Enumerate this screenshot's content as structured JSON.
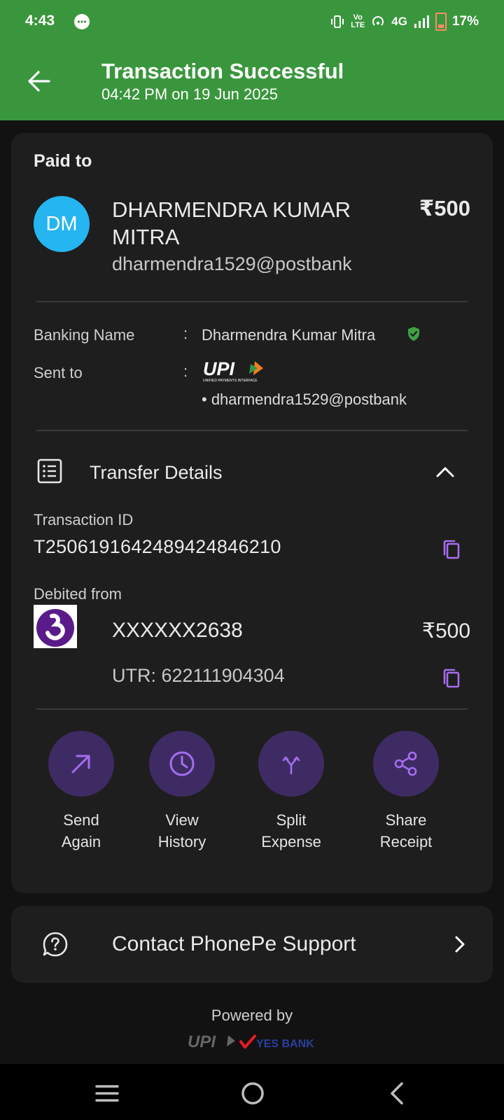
{
  "status_bar": {
    "time": "4:43",
    "network": "4G",
    "volte": "Vo LTE",
    "battery": "17%"
  },
  "header": {
    "title": "Transaction Successful",
    "subtitle": "04:42 PM on 19 Jun 2025",
    "bg_color": "#3a963d"
  },
  "payee": {
    "section_label": "Paid to",
    "initials": "DM",
    "name": "DHARMENDRA KUMAR MITRA",
    "amount": "₹500",
    "upi_id": "dharmendra1529@postbank",
    "avatar_color": "#25b5f1"
  },
  "details": {
    "banking_name_label": "Banking Name",
    "banking_name": "Dharmendra Kumar Mitra",
    "sent_to_label": "Sent to",
    "sent_to_upi": "• dharmendra1529@postbank",
    "colon": ":",
    "upi_logo_text": "UPI",
    "upi_logo_sub": "UNIFIED PAYMENTS INTERFACE"
  },
  "transfer": {
    "section_label": "Transfer Details",
    "txn_id_label": "Transaction ID",
    "txn_id": "T2506191642489424846210",
    "debited_label": "Debited from",
    "account": "XXXXXX2638",
    "amount": "₹500",
    "utr": "UTR: 622111904304"
  },
  "actions": [
    {
      "line1": "Send",
      "line2": "Again",
      "icon": "arrow-up-right-icon"
    },
    {
      "line1": "View",
      "line2": "History",
      "icon": "clock-icon"
    },
    {
      "line1": "Split",
      "line2": "Expense",
      "icon": "split-icon"
    },
    {
      "line1": "Share",
      "line2": "Receipt",
      "icon": "share-icon"
    }
  ],
  "support": {
    "label": "Contact PhonePe Support"
  },
  "footer": {
    "powered_by": "Powered by",
    "bank_name": "YES BANK"
  },
  "colors": {
    "accent": "#a46ef0",
    "action_bg": "#3f2b63",
    "card_bg": "#1e1e1e",
    "page_bg": "#121212",
    "verified": "#3fa046"
  }
}
